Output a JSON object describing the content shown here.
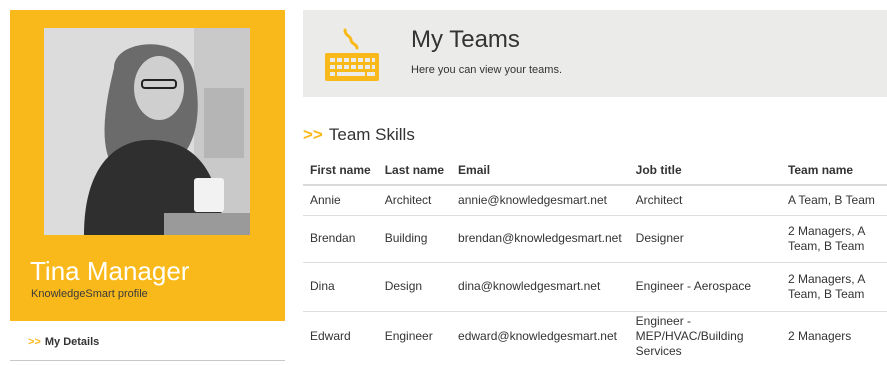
{
  "profile": {
    "name": "Tina Manager",
    "subtitle": "KnowledgeSmart profile",
    "accent_color": "#f9b91a"
  },
  "sidebar": {
    "items": [
      {
        "chevron": ">>",
        "label": "My Details"
      }
    ]
  },
  "banner": {
    "icon": "keyboard-icon",
    "title": "My Teams",
    "subtitle": "Here you can view your teams."
  },
  "section": {
    "chevron": ">>",
    "title": "Team Skills"
  },
  "table": {
    "headers": [
      "First name",
      "Last name",
      "Email",
      "Job title",
      "Team name"
    ],
    "rows": [
      [
        "Annie",
        "Architect",
        "annie@knowledgesmart.net",
        "Architect",
        "A Team, B Team"
      ],
      [
        "Brendan",
        "Building",
        "brendan@knowledgesmart.net",
        "Designer",
        "2 Managers, A Team, B Team"
      ],
      [
        "Dina",
        "Design",
        "dina@knowledgesmart.net",
        "Engineer - Aerospace",
        "2 Managers, A Team, B Team"
      ],
      [
        "Edward",
        "Engineer",
        "edward@knowledgesmart.net",
        "Engineer - MEP/HVAC/Building Services",
        "2 Managers"
      ]
    ]
  }
}
